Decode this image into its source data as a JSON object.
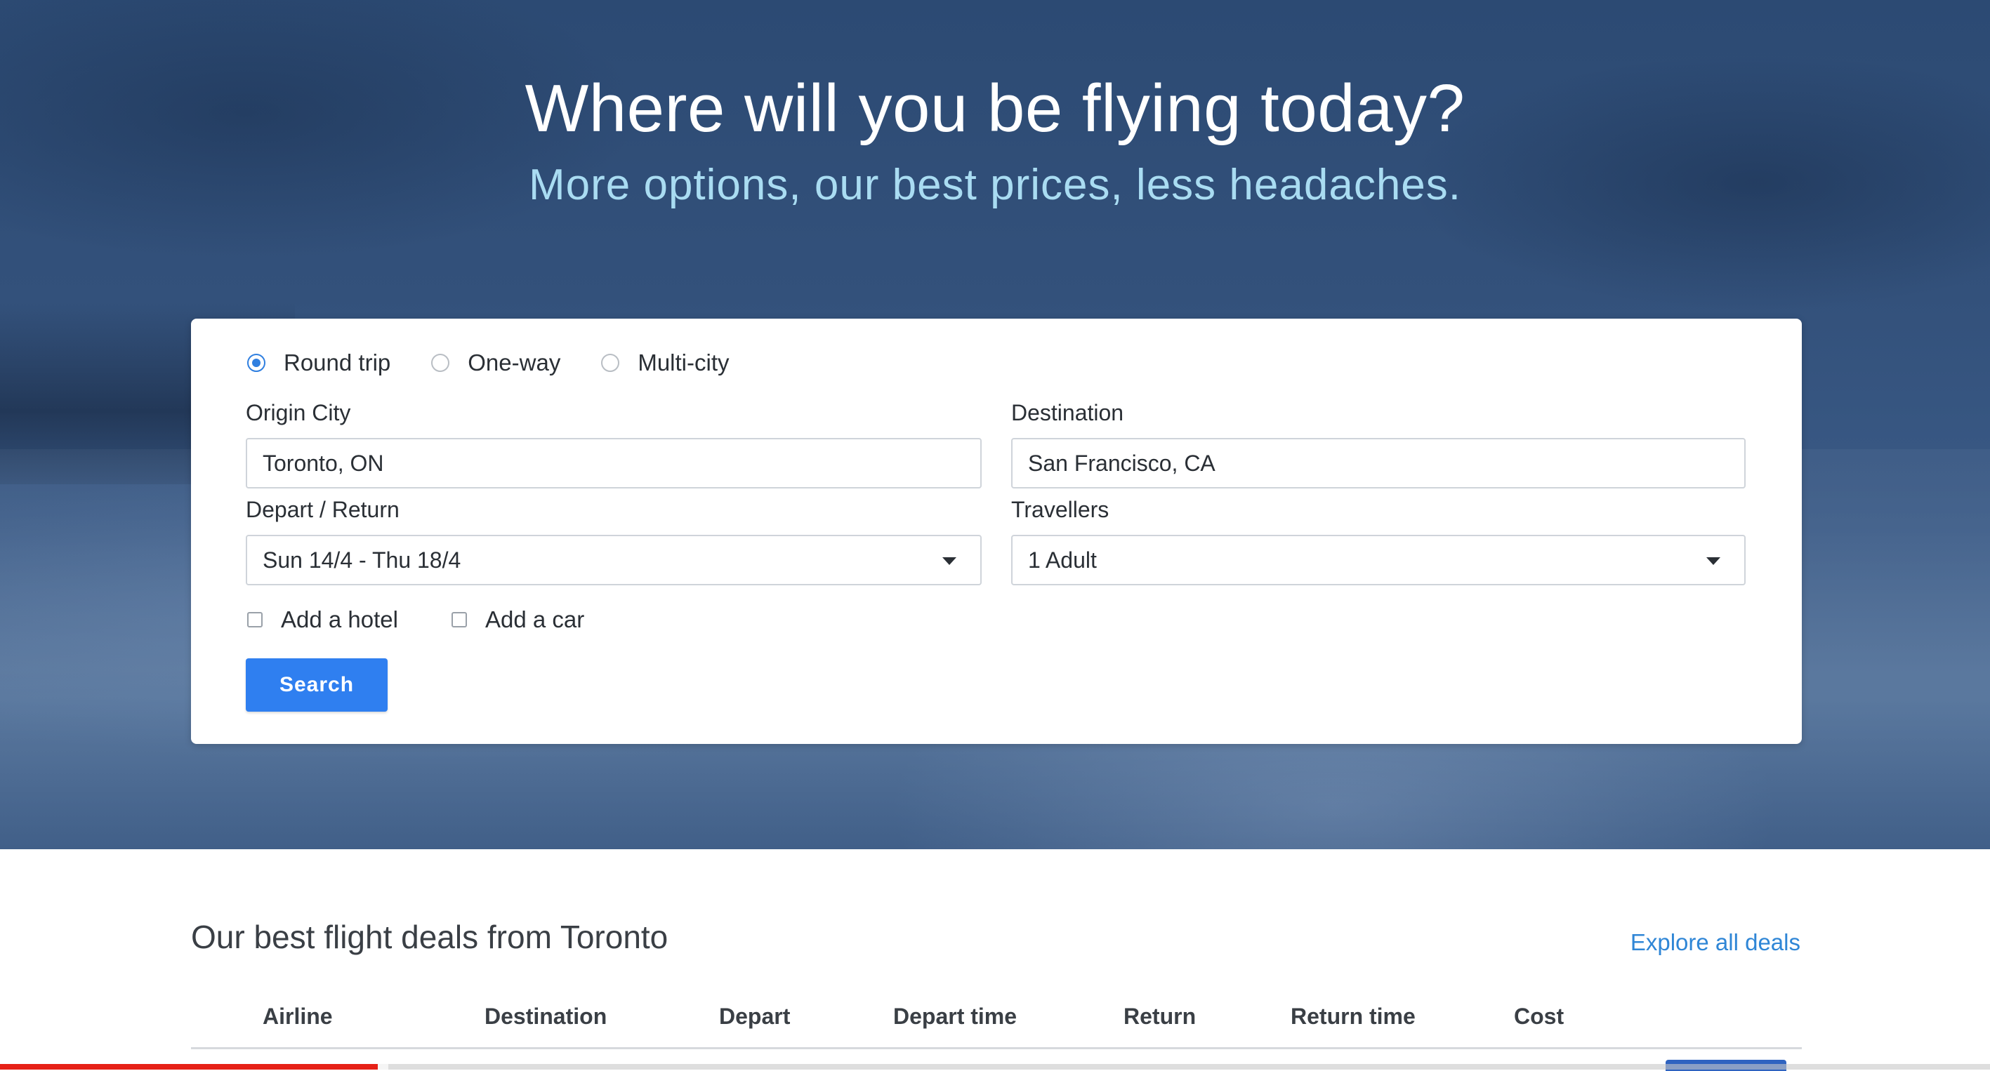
{
  "hero": {
    "title": "Where will you be flying today?",
    "subtitle": "More options, our best prices, less headaches."
  },
  "search_form": {
    "trip_types": [
      {
        "label": "Round trip",
        "selected": true
      },
      {
        "label": "One-way",
        "selected": false
      },
      {
        "label": "Multi-city",
        "selected": false
      }
    ],
    "origin": {
      "label": "Origin City",
      "value": "Toronto, ON"
    },
    "destination": {
      "label": "Destination",
      "value": "San Francisco, CA"
    },
    "dates": {
      "label": "Depart / Return",
      "value": "Sun 14/4 - Thu 18/4"
    },
    "travellers": {
      "label": "Travellers",
      "value": "1 Adult"
    },
    "add_hotel": {
      "label": "Add a hotel",
      "checked": false
    },
    "add_car": {
      "label": "Add a car",
      "checked": false
    },
    "search_label": "Search"
  },
  "deals": {
    "title": "Our best flight deals from Toronto",
    "explore_label": "Explore all deals",
    "columns": [
      "Airline",
      "Destination",
      "Depart",
      "Depart time",
      "Return",
      "Return time",
      "Cost"
    ]
  },
  "video_progress": {
    "played": 0.19,
    "buffered": 0.195
  },
  "colors": {
    "accent": "#2f7ff0",
    "link": "#2f86d6",
    "subtitle": "#a9dcf2",
    "hero_bg": "#33517b",
    "progress": "#e62117"
  }
}
